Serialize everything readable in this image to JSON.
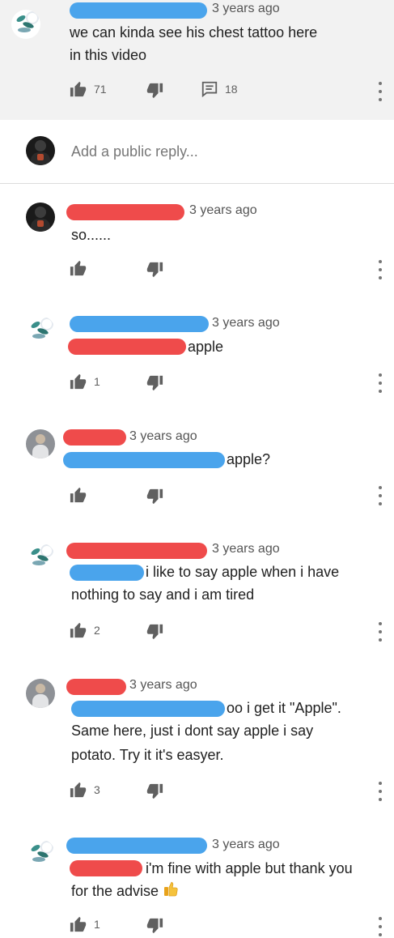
{
  "colors": {
    "redact_blue": "#4aa4ec",
    "redact_red": "#ef4b4b",
    "top_block": "#f2f2f2"
  },
  "parent": {
    "time": "3 years ago",
    "text_line1": "we can kinda see his chest tattoo here",
    "text_line2": "in this video",
    "likes": "71",
    "replies": "18"
  },
  "reply_box": {
    "placeholder": "Add a public reply..."
  },
  "replies": [
    {
      "time": "3 years ago",
      "text": "so......",
      "likes": ""
    },
    {
      "time": "3 years ago",
      "text": "apple",
      "likes": "1"
    },
    {
      "time": "3 years ago",
      "text": "apple?",
      "likes": ""
    },
    {
      "time": "3 years ago",
      "text_line1": "i like to say apple when i have",
      "text_line2": "nothing to say and  i am tired",
      "likes": "2"
    },
    {
      "time": "3 years ago",
      "text_line1": "oo i get it \"Apple\".",
      "text_line2": "Same here, just i dont say apple i say",
      "text_line3": "potato. Try it it's easyer.",
      "likes": "3"
    },
    {
      "time": "3 years ago",
      "text_line1": "i'm fine with apple but thank you",
      "text_line2": "for the advise",
      "likes": "1",
      "emoji": "thumbs-up-emoji"
    }
  ],
  "icons": [
    "like-icon",
    "dislike-icon",
    "reply-count-icon",
    "more-options-icon"
  ]
}
